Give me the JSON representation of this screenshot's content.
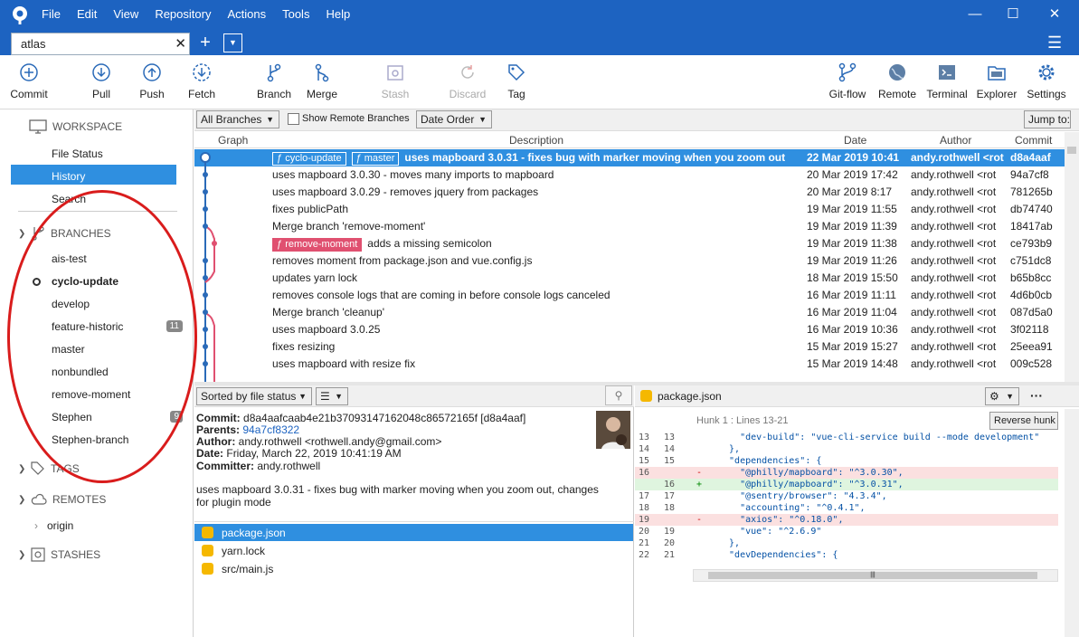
{
  "menu": [
    "File",
    "Edit",
    "View",
    "Repository",
    "Actions",
    "Tools",
    "Help"
  ],
  "tab": {
    "title": "atlas"
  },
  "toolbar": {
    "commit": "Commit",
    "pull": "Pull",
    "push": "Push",
    "fetch": "Fetch",
    "branch": "Branch",
    "merge": "Merge",
    "stash": "Stash",
    "discard": "Discard",
    "tag": "Tag",
    "gitflow": "Git-flow",
    "remote": "Remote",
    "terminal": "Terminal",
    "explorer": "Explorer",
    "settings": "Settings"
  },
  "sidebar": {
    "workspace": "WORKSPACE",
    "file_status": "File Status",
    "history": "History",
    "search": "Search",
    "branches": "BRANCHES",
    "branch_items": [
      {
        "name": "ais-test",
        "badge": ""
      },
      {
        "name": "cyclo-update",
        "badge": ""
      },
      {
        "name": "develop",
        "badge": ""
      },
      {
        "name": "feature-historic",
        "badge": "11"
      },
      {
        "name": "master",
        "badge": ""
      },
      {
        "name": "nonbundled",
        "badge": ""
      },
      {
        "name": "remove-moment",
        "badge": ""
      },
      {
        "name": "Stephen",
        "badge": "9"
      },
      {
        "name": "Stephen-branch",
        "badge": ""
      }
    ],
    "tags": "TAGS",
    "remotes": "REMOTES",
    "origin": "origin",
    "stashes": "STASHES"
  },
  "filters": {
    "branches": "All Branches",
    "show_remote": "Show Remote Branches",
    "order": "Date Order",
    "jump": "Jump to:"
  },
  "columns": {
    "graph": "Graph",
    "description": "Description",
    "date": "Date",
    "author": "Author",
    "commit": "Commit"
  },
  "commits": [
    {
      "desc": "uses mapboard 3.0.31 - fixes bug with marker moving when you zoom out",
      "date": "22 Mar 2019 10:41",
      "author": "andy.rothwell <rot",
      "sha": "d8a4aaf",
      "refs": [
        "cyclo-update",
        "master"
      ]
    },
    {
      "desc": "uses mapboard 3.0.30 - moves many imports to mapboard",
      "date": "20 Mar 2019 17:42",
      "author": "andy.rothwell <rot",
      "sha": "94a7cf8"
    },
    {
      "desc": "uses mapboard 3.0.29 - removes jquery from packages",
      "date": "20 Mar 2019 8:17",
      "author": "andy.rothwell <rot",
      "sha": "781265b"
    },
    {
      "desc": "fixes publicPath",
      "date": "19 Mar 2019 11:55",
      "author": "andy.rothwell <rot",
      "sha": "db74740"
    },
    {
      "desc": "Merge branch 'remove-moment'",
      "date": "19 Mar 2019 11:39",
      "author": "andy.rothwell <rot",
      "sha": "18417ab"
    },
    {
      "desc": "adds a missing semicolon",
      "date": "19 Mar 2019 11:38",
      "author": "andy.rothwell <rot",
      "sha": "ce793b9",
      "refs": [
        "remove-moment"
      ]
    },
    {
      "desc": "removes moment from package.json and vue.config.js",
      "date": "19 Mar 2019 11:26",
      "author": "andy.rothwell <rot",
      "sha": "c751dc8"
    },
    {
      "desc": "updates yarn lock",
      "date": "18 Mar 2019 15:50",
      "author": "andy.rothwell <rot",
      "sha": "b65b8cc"
    },
    {
      "desc": "removes console logs that are coming in before console logs canceled",
      "date": "16 Mar 2019 11:11",
      "author": "andy.rothwell <rot",
      "sha": "4d6b0cb"
    },
    {
      "desc": "Merge branch 'cleanup'",
      "date": "16 Mar 2019 11:04",
      "author": "andy.rothwell <rot",
      "sha": "087d5a0"
    },
    {
      "desc": "uses mapboard 3.0.25",
      "date": "16 Mar 2019 10:36",
      "author": "andy.rothwell <rot",
      "sha": "3f02118"
    },
    {
      "desc": "fixes resizing",
      "date": "15 Mar 2019 15:27",
      "author": "andy.rothwell <rot",
      "sha": "25eea91"
    },
    {
      "desc": "uses mapboard with resize fix",
      "date": "15 Mar 2019 14:48",
      "author": "andy.rothwell <rot",
      "sha": "009c528"
    }
  ],
  "lower": {
    "sort": "Sorted by file status"
  },
  "commit_info": {
    "commit_label": "Commit:",
    "commit": "d8a4aafcaab4e21b37093147162048c86572165f [d8a4aaf]",
    "parents_label": "Parents:",
    "parents": "94a7cf8322",
    "author_label": "Author:",
    "author": "andy.rothwell <rothwell.andy@gmail.com>",
    "date_label": "Date:",
    "date": "Friday, March 22, 2019 10:41:19 AM",
    "committer_label": "Committer:",
    "committer": "andy.rothwell",
    "message1": "uses mapboard 3.0.31 - fixes bug with marker moving when you zoom out, changes",
    "message2": "for plugin mode"
  },
  "files": [
    "package.json",
    "yarn.lock",
    "src/main.js"
  ],
  "diff": {
    "filename": "package.json",
    "hunk": "Hunk 1 : Lines 13-21",
    "reverse": "Reverse hunk",
    "lines": [
      {
        "n1": "13",
        "n2": "13",
        "pm": "",
        "code": "    \"dev-build\": \"vue-cli-service build --mode development\"",
        "type": ""
      },
      {
        "n1": "14",
        "n2": "14",
        "pm": "",
        "code": "  },",
        "type": ""
      },
      {
        "n1": "15",
        "n2": "15",
        "pm": "",
        "code": "  \"dependencies\": {",
        "type": ""
      },
      {
        "n1": "16",
        "n2": "",
        "pm": "-",
        "code": "    \"@philly/mapboard\": \"^3.0.30\",",
        "type": "del"
      },
      {
        "n1": "",
        "n2": "16",
        "pm": "+",
        "code": "    \"@philly/mapboard\": \"^3.0.31\",",
        "type": "add"
      },
      {
        "n1": "17",
        "n2": "17",
        "pm": "",
        "code": "    \"@sentry/browser\": \"4.3.4\",",
        "type": ""
      },
      {
        "n1": "18",
        "n2": "18",
        "pm": "",
        "code": "    \"accounting\": \"^0.4.1\",",
        "type": ""
      },
      {
        "n1": "19",
        "n2": "",
        "pm": "-",
        "code": "    \"axios\": \"^0.18.0\",",
        "type": "del"
      },
      {
        "n1": "20",
        "n2": "19",
        "pm": "",
        "code": "    \"vue\": \"^2.6.9\"",
        "type": ""
      },
      {
        "n1": "21",
        "n2": "20",
        "pm": "",
        "code": "  },",
        "type": ""
      },
      {
        "n1": "22",
        "n2": "21",
        "pm": "",
        "code": "  \"devDependencies\": {",
        "type": ""
      }
    ]
  },
  "colors": {
    "accent": "#1d63c1",
    "selection": "#2f8fe0",
    "annotation": "#d91c1c"
  }
}
